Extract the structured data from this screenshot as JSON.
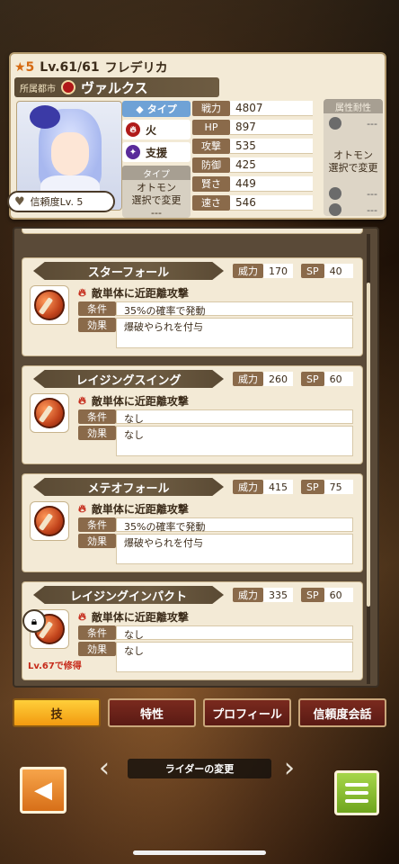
{
  "character": {
    "rarity": "★5",
    "level": "Lv.61/61",
    "name": "フレデリカ",
    "city_label": "所属都市",
    "city_name": "ヴァルクス",
    "trust_label": "信頼度Lv. 5"
  },
  "types": {
    "header": "タイプ",
    "items": [
      {
        "icon": "fire-icon",
        "label": "火"
      },
      {
        "icon": "support-icon",
        "label": "支援"
      }
    ],
    "otomon_header": "タイプ",
    "otomon_text": "オトモン\n選択で変更",
    "otomon_dash": "---"
  },
  "stats": [
    {
      "label": "戦力",
      "value": "4807"
    },
    {
      "label": "HP",
      "value": "897"
    },
    {
      "label": "攻撃",
      "value": "535"
    },
    {
      "label": "防御",
      "value": "425"
    },
    {
      "label": "賢さ",
      "value": "449"
    },
    {
      "label": "速さ",
      "value": "546"
    }
  ],
  "attribute_resistance": {
    "title": "属性耐性",
    "rows": [
      "---",
      "---",
      "---",
      "---"
    ],
    "otomon_text": "オトモン\n選択で変更"
  },
  "skills": [
    {
      "name": "スターフォール",
      "power_label": "威力",
      "power": "170",
      "sp_label": "SP",
      "sp": "40",
      "target": "敵単体に近距離攻撃",
      "cond_label": "条件",
      "cond": "35%の確率で発動",
      "effect_label": "効果",
      "effect": "爆破やられを付与"
    },
    {
      "name": "レイジングスイング",
      "power_label": "威力",
      "power": "260",
      "sp_label": "SP",
      "sp": "60",
      "target": "敵単体に近距離攻撃",
      "cond_label": "条件",
      "cond": "なし",
      "effect_label": "効果",
      "effect": "なし"
    },
    {
      "name": "メテオフォール",
      "power_label": "威力",
      "power": "415",
      "sp_label": "SP",
      "sp": "75",
      "target": "敵単体に近距離攻撃",
      "cond_label": "条件",
      "cond": "35%の確率で発動",
      "effect_label": "効果",
      "effect": "爆破やられを付与"
    },
    {
      "name": "レイジングインパクト",
      "power_label": "威力",
      "power": "335",
      "sp_label": "SP",
      "sp": "60",
      "target": "敵単体に近距離攻撃",
      "cond_label": "条件",
      "cond": "なし",
      "effect_label": "効果",
      "effect": "なし",
      "locked_text": "Lv.67で修得"
    }
  ],
  "tabs": [
    {
      "label": "技",
      "active": true
    },
    {
      "label": "特性",
      "active": false
    },
    {
      "label": "プロフィール",
      "active": false
    },
    {
      "label": "信頼度会話",
      "active": false
    }
  ],
  "nav": {
    "rider_change": "ライダーの変更"
  },
  "colors": {
    "accent_orange": "#f29a10",
    "tab_red": "#7a2a1e",
    "menu_green": "#6fa51e",
    "fire_red": "#c52a1a",
    "lock_text_red": "#c62a1a"
  }
}
